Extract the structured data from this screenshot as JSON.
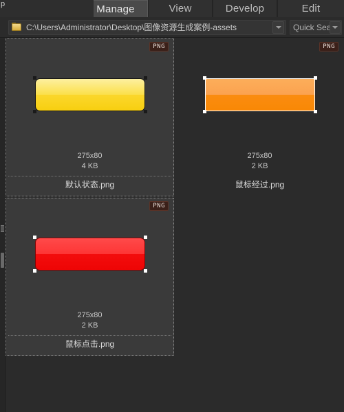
{
  "window": {
    "partial_label": "p",
    "background_color": "#2b2b2b"
  },
  "tabs": [
    {
      "label": "Manage",
      "active": true
    },
    {
      "label": "View",
      "active": false
    },
    {
      "label": "Develop",
      "active": false
    },
    {
      "label": "Edit",
      "active": false
    }
  ],
  "pathbar": {
    "folder_icon": "folder-icon",
    "path": "C:\\Users\\Administrator\\Desktop\\图像资源生成案例-assets",
    "path_dropdown_icon": "chevron-down-icon",
    "search_placeholder": "Quick Sea",
    "search_dropdown_icon": "chevron-down-icon"
  },
  "files": [
    {
      "badge": "PNG",
      "dimensions": "275x80",
      "filesize": "4 KB",
      "filename": "默认状态.png",
      "selected": true,
      "art": {
        "style": "yellow",
        "rounded": true,
        "top_color_start": "#fdf0a0",
        "top_color_end": "#fbe04a",
        "bottom_color_start": "#fbd72c",
        "bottom_color_end": "#f8cf10",
        "border_color": "#161616",
        "handle_color": "#1a1a1a"
      }
    },
    {
      "badge": "PNG",
      "dimensions": "275x80",
      "filesize": "2 KB",
      "filename": "鼠标经过.png",
      "selected": false,
      "art": {
        "style": "orange",
        "rounded": false,
        "top_color_start": "#fcae5a",
        "top_color_end": "#fba250",
        "bottom_color_start": "#fa8c10",
        "bottom_color_end": "#f98805",
        "border_color": "#ffffff",
        "handle_color": "#ffffff"
      }
    },
    {
      "badge": "PNG",
      "dimensions": "275x80",
      "filesize": "2 KB",
      "filename": "鼠标点击.png",
      "selected": true,
      "art": {
        "style": "red",
        "rounded": true,
        "top_color_start": "#ff4a4a",
        "top_color_end": "#fd3535",
        "bottom_color_start": "#f30d0d",
        "bottom_color_end": "#ee0505",
        "border_color": "#7e0606",
        "handle_color": "#ffffff"
      }
    }
  ]
}
